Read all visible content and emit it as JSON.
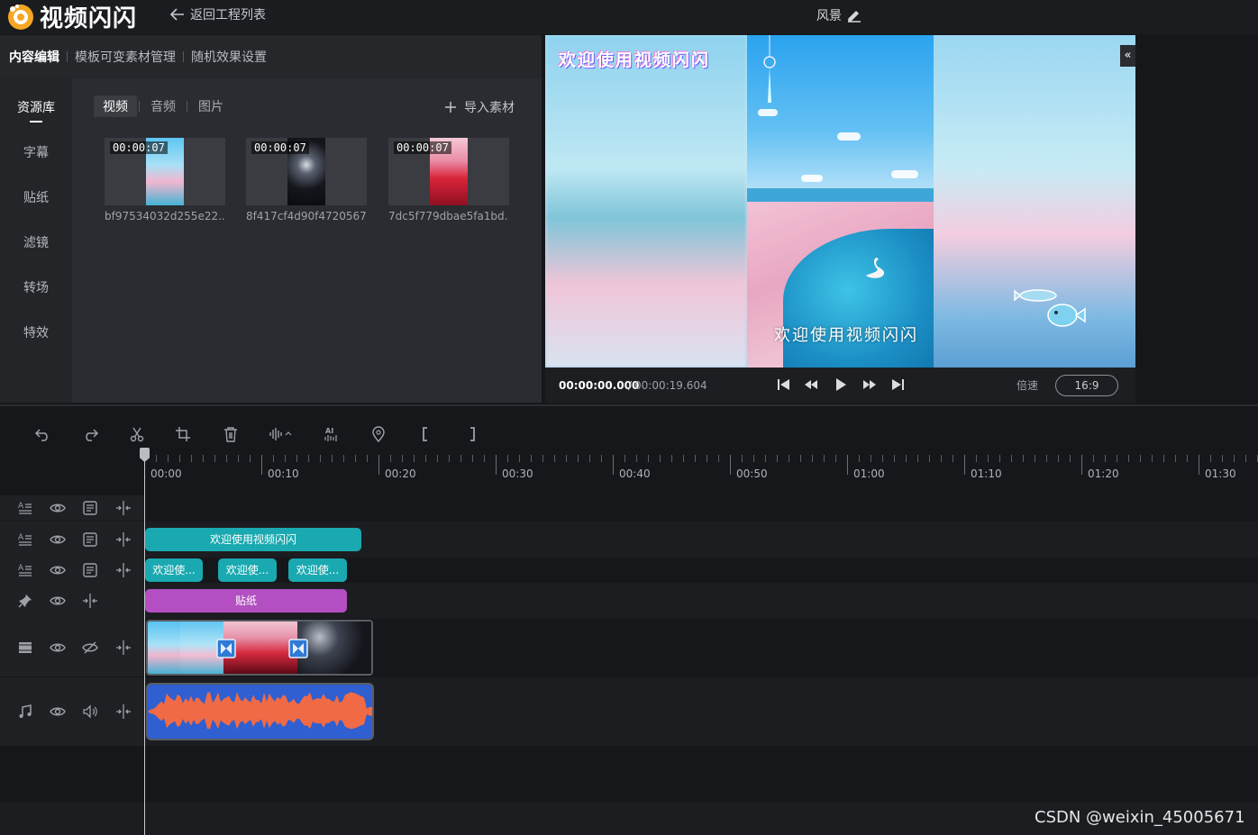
{
  "app": {
    "logo_text": "视频闪闪",
    "back_label": "返回工程列表",
    "project_title": "风景"
  },
  "mode_tabs": [
    "内容编辑",
    "模板可变素材管理",
    "随机效果设置"
  ],
  "side_nav": [
    "资源库",
    "字幕",
    "贴纸",
    "滤镜",
    "转场",
    "特效"
  ],
  "media_tabs": [
    "视频",
    "音频",
    "图片"
  ],
  "import_label": "导入素材",
  "media": [
    {
      "duration": "00:00:07",
      "name": "bf97534032d255e22..."
    },
    {
      "duration": "00:00:07",
      "name": "8f417cf4d90f4720567..."
    },
    {
      "duration": "00:00:07",
      "name": "7dc5f779dbae5fa1bd..."
    }
  ],
  "preview": {
    "overlay_title": "欢迎使用视频闪闪",
    "subtitle": "欢迎使用视频闪闪",
    "time_current": "00:00:00.000",
    "time_sep": "/",
    "time_total": "00:00:19.604",
    "speed_label": "倍速",
    "ratio": "16:9",
    "collapse": "«"
  },
  "ruler_labels": [
    "00:00",
    "00:10",
    "00:20",
    "00:30",
    "00:40",
    "00:50",
    "01:00",
    "01:10",
    "01:20",
    "01:30"
  ],
  "tracks": {
    "text1_clip": "欢迎使用视频闪闪",
    "text2_clips": [
      "欢迎使...",
      "欢迎使...",
      "欢迎使..."
    ],
    "sticker_clip": "贴纸"
  },
  "colors": {
    "text_clip": "#1aa9b0",
    "sticker_clip": "#b34fc2",
    "audio_bg": "#2f5fd0",
    "audio_wave": "#f06a45"
  },
  "watermark": "CSDN @weixin_45005671"
}
